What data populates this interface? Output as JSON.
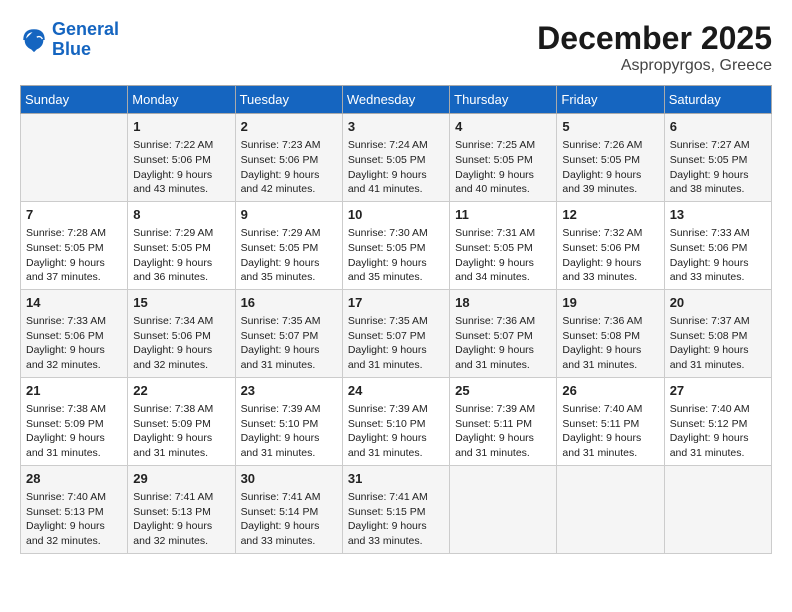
{
  "logo": {
    "line1": "General",
    "line2": "Blue"
  },
  "title": "December 2025",
  "location": "Aspropyrgos, Greece",
  "weekdays": [
    "Sunday",
    "Monday",
    "Tuesday",
    "Wednesday",
    "Thursday",
    "Friday",
    "Saturday"
  ],
  "weeks": [
    [
      {
        "day": null,
        "info": null
      },
      {
        "day": "1",
        "info": "Sunrise: 7:22 AM\nSunset: 5:06 PM\nDaylight: 9 hours\nand 43 minutes."
      },
      {
        "day": "2",
        "info": "Sunrise: 7:23 AM\nSunset: 5:06 PM\nDaylight: 9 hours\nand 42 minutes."
      },
      {
        "day": "3",
        "info": "Sunrise: 7:24 AM\nSunset: 5:05 PM\nDaylight: 9 hours\nand 41 minutes."
      },
      {
        "day": "4",
        "info": "Sunrise: 7:25 AM\nSunset: 5:05 PM\nDaylight: 9 hours\nand 40 minutes."
      },
      {
        "day": "5",
        "info": "Sunrise: 7:26 AM\nSunset: 5:05 PM\nDaylight: 9 hours\nand 39 minutes."
      },
      {
        "day": "6",
        "info": "Sunrise: 7:27 AM\nSunset: 5:05 PM\nDaylight: 9 hours\nand 38 minutes."
      }
    ],
    [
      {
        "day": "7",
        "info": "Sunrise: 7:28 AM\nSunset: 5:05 PM\nDaylight: 9 hours\nand 37 minutes."
      },
      {
        "day": "8",
        "info": "Sunrise: 7:29 AM\nSunset: 5:05 PM\nDaylight: 9 hours\nand 36 minutes."
      },
      {
        "day": "9",
        "info": "Sunrise: 7:29 AM\nSunset: 5:05 PM\nDaylight: 9 hours\nand 35 minutes."
      },
      {
        "day": "10",
        "info": "Sunrise: 7:30 AM\nSunset: 5:05 PM\nDaylight: 9 hours\nand 35 minutes."
      },
      {
        "day": "11",
        "info": "Sunrise: 7:31 AM\nSunset: 5:05 PM\nDaylight: 9 hours\nand 34 minutes."
      },
      {
        "day": "12",
        "info": "Sunrise: 7:32 AM\nSunset: 5:06 PM\nDaylight: 9 hours\nand 33 minutes."
      },
      {
        "day": "13",
        "info": "Sunrise: 7:33 AM\nSunset: 5:06 PM\nDaylight: 9 hours\nand 33 minutes."
      }
    ],
    [
      {
        "day": "14",
        "info": "Sunrise: 7:33 AM\nSunset: 5:06 PM\nDaylight: 9 hours\nand 32 minutes."
      },
      {
        "day": "15",
        "info": "Sunrise: 7:34 AM\nSunset: 5:06 PM\nDaylight: 9 hours\nand 32 minutes."
      },
      {
        "day": "16",
        "info": "Sunrise: 7:35 AM\nSunset: 5:07 PM\nDaylight: 9 hours\nand 31 minutes."
      },
      {
        "day": "17",
        "info": "Sunrise: 7:35 AM\nSunset: 5:07 PM\nDaylight: 9 hours\nand 31 minutes."
      },
      {
        "day": "18",
        "info": "Sunrise: 7:36 AM\nSunset: 5:07 PM\nDaylight: 9 hours\nand 31 minutes."
      },
      {
        "day": "19",
        "info": "Sunrise: 7:36 AM\nSunset: 5:08 PM\nDaylight: 9 hours\nand 31 minutes."
      },
      {
        "day": "20",
        "info": "Sunrise: 7:37 AM\nSunset: 5:08 PM\nDaylight: 9 hours\nand 31 minutes."
      }
    ],
    [
      {
        "day": "21",
        "info": "Sunrise: 7:38 AM\nSunset: 5:09 PM\nDaylight: 9 hours\nand 31 minutes."
      },
      {
        "day": "22",
        "info": "Sunrise: 7:38 AM\nSunset: 5:09 PM\nDaylight: 9 hours\nand 31 minutes."
      },
      {
        "day": "23",
        "info": "Sunrise: 7:39 AM\nSunset: 5:10 PM\nDaylight: 9 hours\nand 31 minutes."
      },
      {
        "day": "24",
        "info": "Sunrise: 7:39 AM\nSunset: 5:10 PM\nDaylight: 9 hours\nand 31 minutes."
      },
      {
        "day": "25",
        "info": "Sunrise: 7:39 AM\nSunset: 5:11 PM\nDaylight: 9 hours\nand 31 minutes."
      },
      {
        "day": "26",
        "info": "Sunrise: 7:40 AM\nSunset: 5:11 PM\nDaylight: 9 hours\nand 31 minutes."
      },
      {
        "day": "27",
        "info": "Sunrise: 7:40 AM\nSunset: 5:12 PM\nDaylight: 9 hours\nand 31 minutes."
      }
    ],
    [
      {
        "day": "28",
        "info": "Sunrise: 7:40 AM\nSunset: 5:13 PM\nDaylight: 9 hours\nand 32 minutes."
      },
      {
        "day": "29",
        "info": "Sunrise: 7:41 AM\nSunset: 5:13 PM\nDaylight: 9 hours\nand 32 minutes."
      },
      {
        "day": "30",
        "info": "Sunrise: 7:41 AM\nSunset: 5:14 PM\nDaylight: 9 hours\nand 33 minutes."
      },
      {
        "day": "31",
        "info": "Sunrise: 7:41 AM\nSunset: 5:15 PM\nDaylight: 9 hours\nand 33 minutes."
      },
      {
        "day": null,
        "info": null
      },
      {
        "day": null,
        "info": null
      },
      {
        "day": null,
        "info": null
      }
    ]
  ]
}
